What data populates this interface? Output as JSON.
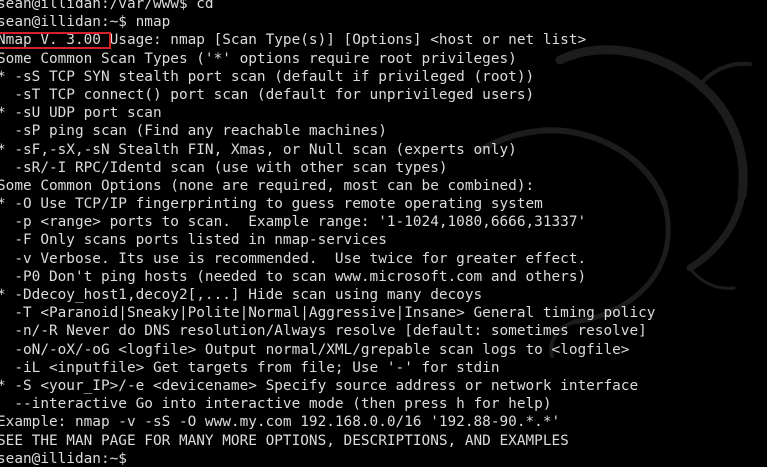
{
  "terminal": {
    "colors": {
      "background": "#000000",
      "foreground": "#dcdcdc",
      "highlight_border": "#d2232a",
      "wallpaper_shape": "#1c1c1c"
    },
    "lines": [
      "sean@illidan:/var/www$ cd",
      "sean@illidan:~$ nmap",
      "Nmap V. 3.00 Usage: nmap [Scan Type(s)] [Options] <host or net list>",
      "Some Common Scan Types ('*' options require root privileges)",
      "* -sS TCP SYN stealth port scan (default if privileged (root))",
      "  -sT TCP connect() port scan (default for unprivileged users)",
      "* -sU UDP port scan",
      "  -sP ping scan (Find any reachable machines)",
      "* -sF,-sX,-sN Stealth FIN, Xmas, or Null scan (experts only)",
      "  -sR/-I RPC/Identd scan (use with other scan types)",
      "Some Common Options (none are required, most can be combined):",
      "* -O Use TCP/IP fingerprinting to guess remote operating system",
      "  -p <range> ports to scan.  Example range: '1-1024,1080,6666,31337'",
      "  -F Only scans ports listed in nmap-services",
      "  -v Verbose. Its use is recommended.  Use twice for greater effect.",
      "  -P0 Don't ping hosts (needed to scan www.microsoft.com and others)",
      "* -Ddecoy_host1,decoy2[,...] Hide scan using many decoys",
      "  -T <Paranoid|Sneaky|Polite|Normal|Aggressive|Insane> General timing policy",
      "  -n/-R Never do DNS resolution/Always resolve [default: sometimes resolve]",
      "  -oN/-oX/-oG <logfile> Output normal/XML/grepable scan logs to <logfile>",
      "  -iL <inputfile> Get targets from file; Use '-' for stdin",
      "* -S <your_IP>/-e <devicename> Specify source address or network interface",
      "  --interactive Go into interactive mode (then press h for help)",
      "Example: nmap -v -sS -O www.my.com 192.168.0.0/16 '192.88-90.*.*'",
      "SEE THE MAN PAGE FOR MANY MORE OPTIONS, DESCRIPTIONS, AND EXAMPLES",
      "sean@illidan:~$"
    ]
  }
}
